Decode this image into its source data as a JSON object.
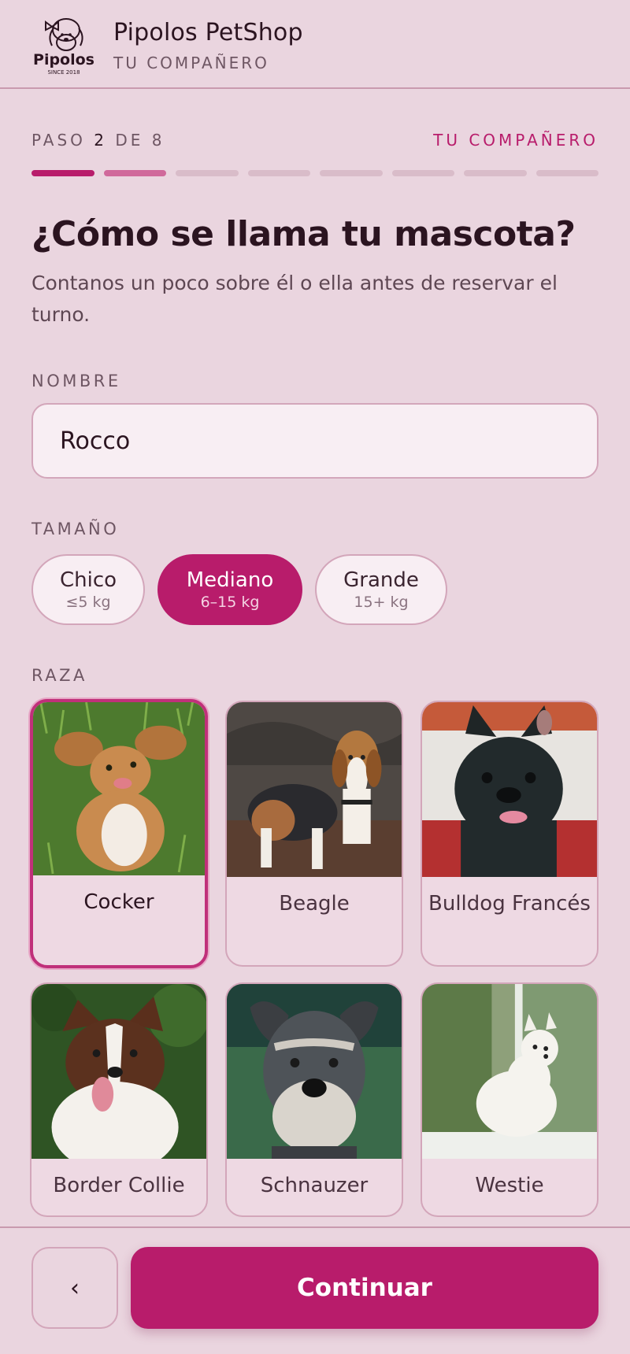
{
  "header": {
    "brand_name": "Pipolos PetShop",
    "brand_sub": "TU COMPAÑERO",
    "logo_text": "Pipolos",
    "logo_since": "SINCE 2018"
  },
  "steps": {
    "prefix": "PASO",
    "current": "2",
    "separator": "DE",
    "total": "8",
    "section": "TU COMPAÑERO",
    "progress_done": 2,
    "progress_total": 8
  },
  "form": {
    "title": "¿Cómo se llama tu mascota?",
    "subtitle": "Contanos un poco sobre él o ella antes de reservar el turno.",
    "name_label": "NOMBRE",
    "name_value": "Rocco",
    "size_label": "TAMAÑO",
    "sizes": [
      {
        "name": "Chico",
        "weight": "≤5 kg"
      },
      {
        "name": "Mediano",
        "weight": "6–15 kg"
      },
      {
        "name": "Grande",
        "weight": "15+ kg"
      }
    ],
    "selected_size": "Mediano",
    "breed_label": "RAZA",
    "breeds": [
      {
        "name": "Cocker"
      },
      {
        "name": "Beagle"
      },
      {
        "name": "Bulldog Francés"
      },
      {
        "name": "Border Collie"
      },
      {
        "name": "Schnauzer"
      },
      {
        "name": "Westie"
      }
    ],
    "selected_breed": "Cocker"
  },
  "footer": {
    "back_label": "‹",
    "continue_label": "Continuar"
  },
  "colors": {
    "background": "#ead5df",
    "accent": "#b81c6b",
    "text": "#2b1420"
  }
}
